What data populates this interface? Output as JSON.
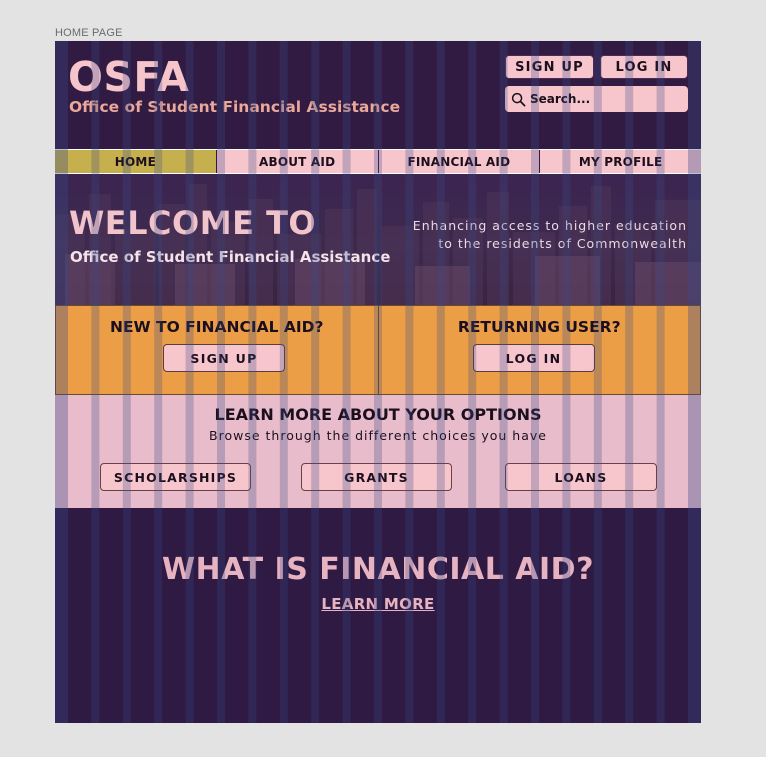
{
  "frame_label": "HOME PAGE",
  "colors": {
    "dark": "#321b43",
    "pink": "#f7c5cc",
    "orange": "#ec9e46",
    "nav_active": "#c6b04e",
    "grid_stripe": "#3a4a8a"
  },
  "header": {
    "logo": "OSFA",
    "subtitle": "Office of Student Financial Assistance",
    "sign_up_label": "SIGN UP",
    "log_in_label": "LOG IN",
    "search_placeholder": "Search...",
    "search_icon": "search-icon"
  },
  "nav": {
    "items": [
      {
        "label": "HOME",
        "active": true
      },
      {
        "label": "ABOUT AID",
        "active": false
      },
      {
        "label": "FINANCIAL AID",
        "active": false
      },
      {
        "label": "MY PROFILE",
        "active": false
      }
    ]
  },
  "hero": {
    "title": "WELCOME TO",
    "subtitle": "Office of Student Financial Assistance",
    "tagline_line1": "Enhancing access to higher education",
    "tagline_line2": "to the residents of Commonwealth"
  },
  "cta": {
    "new_title": "NEW TO FINANCIAL AID?",
    "new_button": "SIGN UP",
    "returning_title": "RETURNING USER?",
    "returning_button": "LOG IN"
  },
  "options": {
    "title": "LEARN MORE ABOUT YOUR OPTIONS",
    "subtitle": "Browse through the different choices you have",
    "buttons": [
      "SCHOLARSHIPS",
      "GRANTS",
      "LOANS"
    ]
  },
  "whatis": {
    "title": "WHAT IS FINANCIAL AID?",
    "link": "LEARN MORE"
  }
}
